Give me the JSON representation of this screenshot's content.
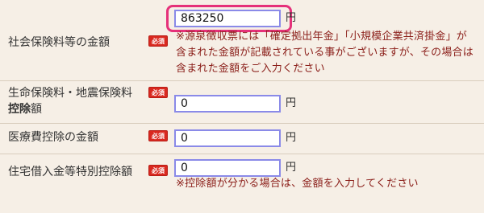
{
  "rows": [
    {
      "label": "社会保険料等の金額",
      "badge": "必須",
      "value": "863250",
      "unit": "円",
      "note": "※源泉徴収票には「確定拠出年金」「小規模企業共済掛金」が含まれた金額が記載されている事がございますが、その場合は含まれた金額をご入力ください"
    },
    {
      "label_line1": "生命保険料・地震保険料",
      "label_line2_bold": "控除",
      "label_line2_rest": "額",
      "badge": "必須",
      "value": "0",
      "unit": "円"
    },
    {
      "label": "医療費控除の金額",
      "badge": "必須",
      "value": "0",
      "unit": "円"
    },
    {
      "label": "住宅借入金等特別控除額",
      "badge": "必須",
      "value": "0",
      "unit": "円",
      "note": "※控除額が分かる場合は、金額を入力してください"
    }
  ],
  "colors": {
    "background": "#f6efe6",
    "badge": "#d9281f",
    "note_text": "#8b1f1a",
    "input_border": "#8a8ae8",
    "highlight": "#e5317a"
  }
}
